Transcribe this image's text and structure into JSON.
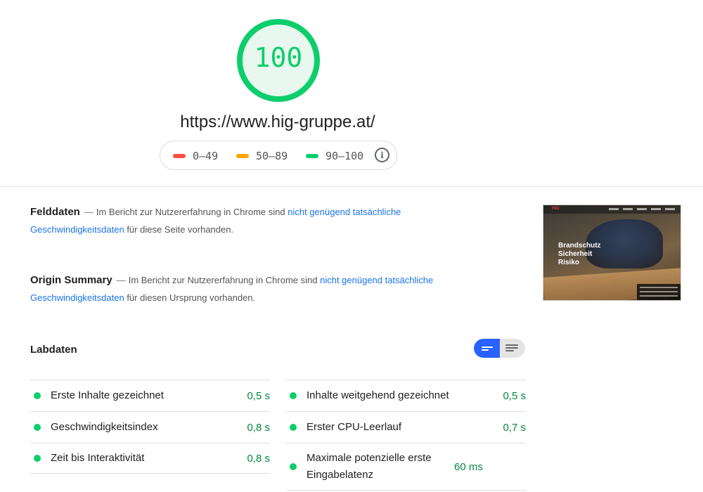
{
  "score": {
    "value": "100",
    "color": "#0cce6b"
  },
  "url": "https://www.hig-gruppe.at/",
  "legend": {
    "items": [
      {
        "label": "0–49",
        "color": "#ff4e42"
      },
      {
        "label": "50–89",
        "color": "#ffa400"
      },
      {
        "label": "90–100",
        "color": "#0cce6b"
      }
    ],
    "info_icon": "info-icon"
  },
  "felddaten": {
    "title": "Felddaten",
    "text_before": "Im Bericht zur Nutzererfahrung in Chrome sind ",
    "link": "nicht genügend tatsächliche Geschwindigkeitsdaten",
    "text_after": " für diese Seite vorhanden."
  },
  "origin": {
    "title": "Origin Summary",
    "text_before": "Im Bericht zur Nutzererfahrung in Chrome sind ",
    "link": "nicht genügend tatsächliche Geschwindigkeitsdaten",
    "text_after": " für diesen Ursprung vorhanden."
  },
  "screenshot": {
    "logo": "HIG",
    "headline": [
      "Brandschutz",
      "Sicherheit",
      "Risiko"
    ]
  },
  "labdaten": {
    "title": "Labdaten",
    "toggle": [
      "compact-view-icon",
      "list-view-icon"
    ],
    "left_metrics": [
      {
        "label": "Erste Inhalte gezeichnet",
        "value": "0,5 s"
      },
      {
        "label": "Geschwindigkeitsindex",
        "value": "0,8 s"
      },
      {
        "label": "Zeit bis Interaktivität",
        "value": "0,8 s"
      }
    ],
    "right_metrics": [
      {
        "label": "Inhalte weitgehend gezeichnet",
        "value": "0,5 s"
      },
      {
        "label": "Erster CPU-Leerlauf",
        "value": "0,7 s"
      },
      {
        "label": "Maximale potenzielle erste Eingabelatenz",
        "value": "60 ms"
      }
    ]
  }
}
